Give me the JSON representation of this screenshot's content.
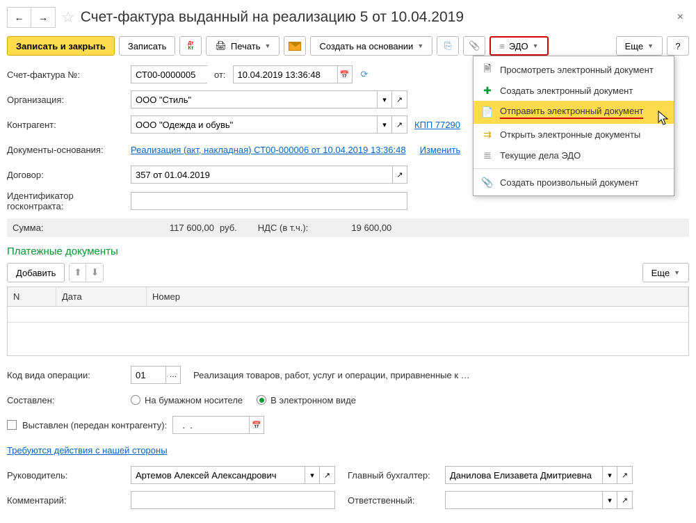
{
  "header": {
    "title": "Счет-фактура выданный на реализацию 5 от 10.04.2019"
  },
  "toolbar": {
    "write_close": "Записать и закрыть",
    "write": "Записать",
    "print": "Печать",
    "create_based": "Создать на основании",
    "edo": "ЭДО",
    "more": "Еще",
    "help": "?"
  },
  "fields": {
    "invoice_no_label": "Счет-фактура №:",
    "invoice_no": "СТ00-0000005",
    "from_label": "от:",
    "from_date": "10.04.2019 13:36:48",
    "org_label": "Организация:",
    "org": "ООО \"Стиль\"",
    "counterparty_label": "Контрагент:",
    "counterparty": "ООО \"Одежда и обувь\"",
    "kpp_link": "КПП 77290",
    "basis_label": "Документы-основания:",
    "basis_link": "Реализация (акт, накладная) СТ00-000006 от 10.04.2019 13:36:48",
    "change_link": "Изменить",
    "contract_label": "Договор:",
    "contract": "357 от 01.04.2019",
    "govcontract_label": "Идентификатор госконтракта:",
    "govcontract": ""
  },
  "sum": {
    "label": "Сумма:",
    "value": "117 600,00",
    "currency": "руб.",
    "vat_label": "НДС (в т.ч.):",
    "vat_value": "19 600,00"
  },
  "payments": {
    "title": "Платежные документы",
    "add": "Добавить",
    "more": "Еще",
    "cols": {
      "n": "N",
      "date": "Дата",
      "number": "Номер"
    }
  },
  "bottom": {
    "opcode_label": "Код вида операции:",
    "opcode": "01",
    "opcode_desc": "Реализация товаров, работ, услуг и операции, приравненные к …",
    "composed_label": "Составлен:",
    "paper": "На бумажном носителе",
    "electronic": "В электронном виде",
    "issued_label": "Выставлен (передан контрагенту):",
    "issued_date": "  .  .    ",
    "action_link": "Требуются действия с нашей стороны",
    "manager_label": "Руководитель:",
    "manager": "Артемов Алексей Александрович",
    "accountant_label": "Главный бухгалтер:",
    "accountant": "Данилова Елизавета Дмитриевна",
    "comment_label": "Комментарий:",
    "responsible_label": "Ответственный:"
  },
  "edo_menu": {
    "view": "Просмотреть электронный документ",
    "create": "Создать электронный документ",
    "send": "Отправить электронный документ",
    "open": "Открыть электронные документы",
    "current": "Текущие дела ЭДО",
    "arbitrary": "Создать произвольный документ"
  }
}
